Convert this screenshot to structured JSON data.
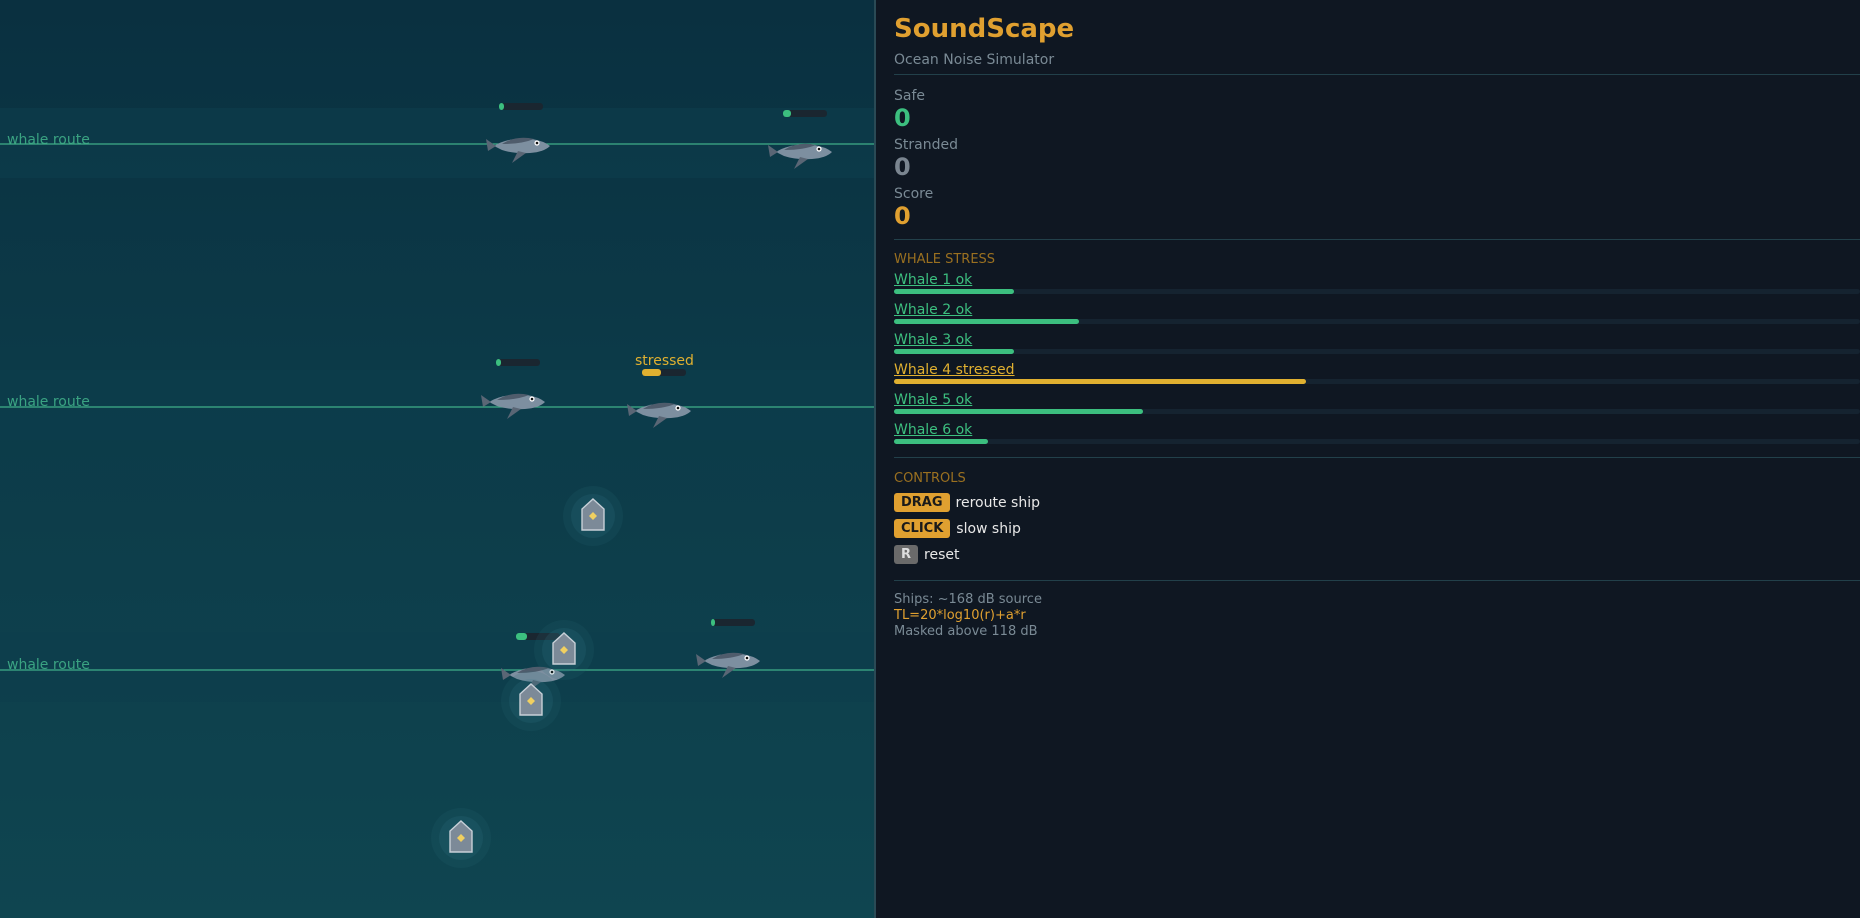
{
  "game": {
    "routes": [
      {
        "label": "whale route"
      },
      {
        "label": "whale route"
      },
      {
        "label": "whale route"
      }
    ],
    "stressed_label": "stressed"
  },
  "panel": {
    "title": "SoundScape",
    "subtitle": "Ocean Noise Simulator",
    "stats": {
      "safe_label": "Safe",
      "safe_value": "0",
      "stranded_label": "Stranded",
      "stranded_value": "0",
      "score_label": "Score",
      "score_value": "0"
    },
    "whale_stress_heading": "WHALE STRESS",
    "whales": [
      {
        "label": "Whale 1  ok",
        "stress": 0.124,
        "color": "#3cbf7f"
      },
      {
        "label": "Whale 2  ok",
        "stress": 0.191,
        "color": "#3cbf7f"
      },
      {
        "label": "Whale 3  ok",
        "stress": 0.124,
        "color": "#3cbf7f"
      },
      {
        "label": "Whale 4  stressed",
        "stress": 0.427,
        "color": "#e0b030"
      },
      {
        "label": "Whale 5  ok",
        "stress": 0.258,
        "color": "#3cbf7f"
      },
      {
        "label": "Whale 6  ok",
        "stress": 0.097,
        "color": "#3cbf7f"
      }
    ],
    "controls_heading": "CONTROLS",
    "controls": [
      {
        "key": "DRAG",
        "label": "reroute ship"
      },
      {
        "key": "CLICK",
        "label": "slow ship"
      },
      {
        "key": "R",
        "label": "reset"
      }
    ],
    "info": {
      "line1": "Ships: ~168 dB source",
      "line2": "TL=20*log10(r)+a*r",
      "line3": "Masked above 118 dB"
    }
  },
  "colors": {
    "accent": "#e0a030",
    "ok": "#3cbf7f",
    "stressed": "#e0b030"
  }
}
